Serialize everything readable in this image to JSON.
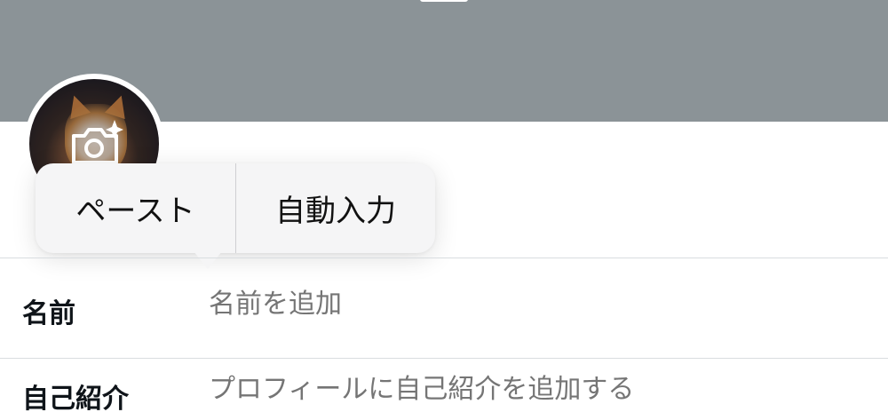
{
  "profile_editor": {
    "fields": [
      {
        "label": "名前",
        "placeholder": "名前を追加",
        "value": ""
      },
      {
        "label": "自己紹介",
        "placeholder": "プロフィールに自己紹介を追加する",
        "value": ""
      }
    ]
  },
  "context_menu": {
    "items": [
      {
        "label": "ペースト"
      },
      {
        "label": "自動入力"
      }
    ]
  },
  "icons": {
    "avatar_overlay": "camera-sparkle-icon"
  },
  "colors": {
    "banner": "#8b9397",
    "popover_bg": "#f5f5f6",
    "placeholder": "#6b7680",
    "divider": "#d9dde0"
  }
}
